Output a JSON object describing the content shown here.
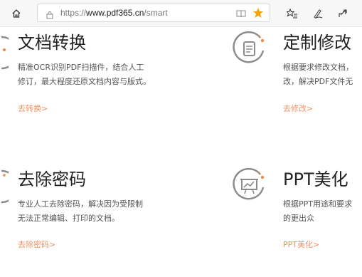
{
  "browser": {
    "url_prefix": "https://",
    "url_host": "www.pdf365.cn",
    "url_path": "/smart",
    "accent": "#f0a500"
  },
  "cards": [
    {
      "title": "文档转换",
      "desc": "精准OCR识别PDF扫描件，结合人工\n修订，最大程度还原文档内容与版式。",
      "link": "去转换>"
    },
    {
      "title": "定制修改",
      "desc": "根据要求修改文档，\n改，解决PDF文件无",
      "link": "去修改>"
    },
    {
      "title": "去除密码",
      "desc": "专业人工去除密码，解决因为受限制\n无法正常编辑、打印的文档。",
      "link": "去除密码>"
    },
    {
      "title": "PPT美化",
      "desc": "根据PPT用途和要求\n的更出众",
      "link": "PPT美化>"
    }
  ],
  "colors": {
    "link": "#f0915f",
    "icon_stroke": "#8c8c8c",
    "icon_accent": "#f08a4b"
  }
}
